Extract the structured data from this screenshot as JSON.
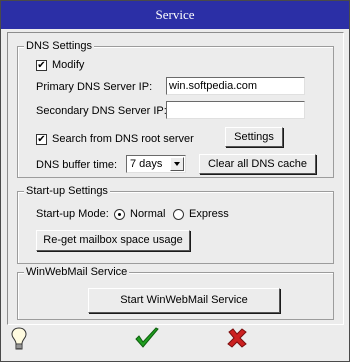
{
  "window": {
    "title": "Service"
  },
  "dns": {
    "legend": "DNS Settings",
    "modify_label": "Modify",
    "modify_checked": true,
    "primary_label": "Primary DNS Server IP:",
    "primary_value": "win.softpedia.com",
    "secondary_label": "Secondary DNS Server IP:",
    "secondary_value": "",
    "root_label": "Search from DNS root server",
    "root_checked": true,
    "settings_button": "Settings",
    "buffer_label": "DNS buffer time:",
    "buffer_value": "7 days",
    "clear_button": "Clear all DNS cache"
  },
  "startup": {
    "legend": "Start-up Settings",
    "mode_label": "Start-up Mode:",
    "normal_label": "Normal",
    "express_label": "Express",
    "selected_mode": "Normal",
    "reget_button": "Re-get mailbox space usage"
  },
  "service": {
    "legend": "WinWebMail Service",
    "start_button": "Start WinWebMail Service"
  },
  "footer": {
    "hint_icon": "lightbulb-icon",
    "ok_icon": "green-checkmark-icon",
    "cancel_icon": "red-x-icon"
  }
}
